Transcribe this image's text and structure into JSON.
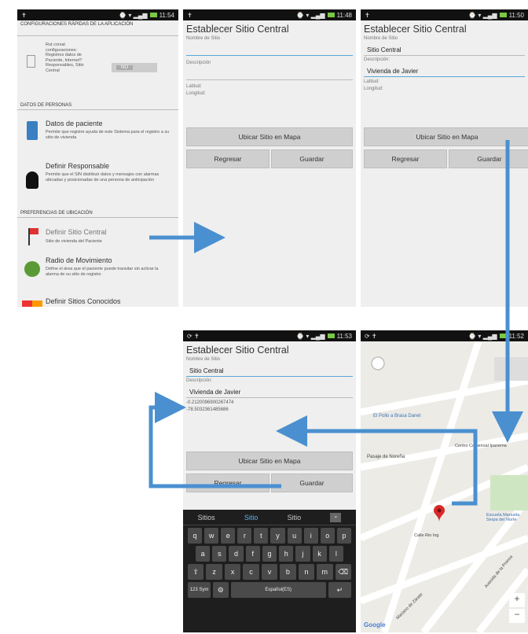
{
  "status": {
    "t1": "11:54",
    "t2": "11:48",
    "t3": "11:50",
    "t4": "11:53",
    "t5": "11:52"
  },
  "p1": {
    "sec1": "CONFIGURACIONES RÁPIDAS DE LA APLICACIÓN",
    "quick_desc": "Rut corsal configuraciones: Registros datos de Paciente, Internet? Responsables, Sitio Central",
    "toggle": "NO",
    "sec2": "DATOS DE PERSONAS",
    "item1_title": "Datos de paciente",
    "item1_desc": "Permite que registre ayuda de este Sistema para el registro a su sitio de vivienda",
    "item2_title": "Definir Responsable",
    "item2_desc": "Permite que el SIN distribuir datos y mensajes con alarmas ubicadas y posicionadas de una persona de anticipación",
    "sec3": "PREFERENCIAS DE UBICACIÓN",
    "item3_title": "Definir Sitio Central",
    "item3_desc": "Sitio de vivienda del Paciente",
    "item4_title": "Radio de Movimiento",
    "item4_desc": "Define el área que el paciente puede transitar sin activar la alarma de su sitio de registro",
    "item5_title": "Definir Sitios Conocidos"
  },
  "form": {
    "title": "Establecer Sitio Central",
    "name_label": "Nombre de Sitio",
    "desc_label": "Descripción",
    "desc_label2": "Descripción:",
    "lat": "Latitud:",
    "lon": "Longitud:",
    "btn_map": "Ubicar Sitio en Mapa",
    "btn_back": "Regresar",
    "btn_save": "Guardar",
    "name_value": "Sitio Central",
    "desc_value": "Vivienda de Javier",
    "lat_value": "-0.2120096900267474",
    "lon_value": "-78.5032361485686"
  },
  "keyboard": {
    "sugg": [
      "Sitios",
      "Sitio",
      "Sitio"
    ],
    "row1": [
      "q",
      "w",
      "e",
      "r",
      "t",
      "y",
      "u",
      "i",
      "o",
      "p"
    ],
    "row2": [
      "a",
      "s",
      "d",
      "f",
      "g",
      "h",
      "j",
      "k",
      "l"
    ],
    "row3": [
      "⇧",
      "z",
      "x",
      "c",
      "v",
      "b",
      "n",
      "m",
      "⌫"
    ],
    "row4": [
      "123 Sym",
      "⚙",
      "Español(ES)",
      "↵"
    ]
  },
  "map": {
    "labels": [
      "El Pollo a Brasa Danet",
      "Pasaje de Noreña",
      "Calle Rio Ing",
      "Mariano de Zárate",
      "Centro Comercial Ipanema",
      "Escuela Manuela Serpa del Norte",
      "Avenida de la Prensa"
    ],
    "google": "Google",
    "zoom_in": "+",
    "zoom_out": "−"
  },
  "colors": {
    "accent": "#5aa7d9",
    "arrow": "#4a90d0",
    "pin": "#d82a2a"
  }
}
